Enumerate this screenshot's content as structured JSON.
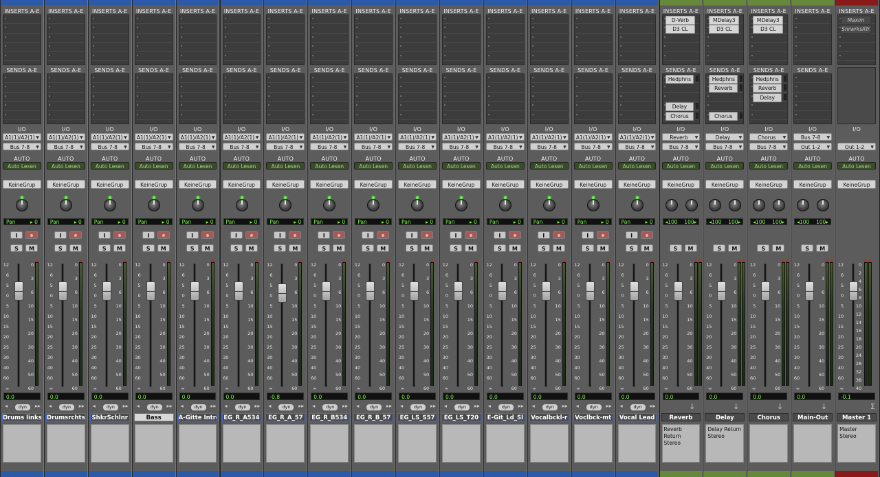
{
  "labels": {
    "inserts": "INSERTS A-E",
    "sends": "SENDS A-E",
    "io": "I/O",
    "auto": "AUTO",
    "auto_mode": "Auto Lesen",
    "group": "KeineGrup",
    "pan": "Pan",
    "pan_value": "0",
    "dyn": "dyn",
    "input_btn": "I",
    "solo": "S",
    "mute": "M"
  },
  "colors": {
    "blue": "#2c5aa8",
    "green": "#66883a",
    "red": "#8a1a1a"
  },
  "fader_scale": [
    "12",
    "6",
    "5",
    "0",
    "5",
    "10",
    "15",
    "20",
    "25",
    "30",
    "40",
    "60",
    "∞"
  ],
  "meter_scale": [
    "0",
    "3",
    "6",
    "10",
    "15",
    "20",
    "30",
    "40",
    "50",
    "60"
  ],
  "master_scale": [
    "0",
    "2",
    "4",
    "6",
    "8",
    "10",
    "12",
    "14",
    "16",
    "18",
    "20",
    "24",
    "28",
    "32",
    "38",
    "40"
  ],
  "tracks": [
    {
      "name": "Drums links",
      "in": "A1(1)/A2(1)",
      "out": "Bus 7-8",
      "vol": "0.0",
      "color": "blue",
      "selected": false,
      "inserts": [],
      "sends": []
    },
    {
      "name": "Drumsrchts",
      "in": "A1(1)/A2(1)",
      "out": "Bus 7-8",
      "vol": "0.0",
      "color": "blue",
      "selected": false,
      "inserts": [],
      "sends": []
    },
    {
      "name": "ShkrSchlnr",
      "in": "A1(1)/A2(1)",
      "out": "Bus 7-8",
      "vol": "0.0",
      "color": "blue",
      "selected": false,
      "inserts": [],
      "sends": []
    },
    {
      "name": "Bass",
      "in": "A1(1)/A2(1)",
      "out": "Bus 7-8",
      "vol": "0.0",
      "color": "blue",
      "selected": true,
      "inserts": [],
      "sends": []
    },
    {
      "name": "A-Gitte Intro",
      "in": "A1(1)/A2(1)",
      "out": "Bus 7-8",
      "vol": "0.0",
      "color": "blue",
      "selected": false,
      "inserts": [],
      "sends": []
    },
    {
      "name": "EG_R_A534",
      "in": "A1(1)/A2(1)",
      "out": "Bus 7-8",
      "vol": "0.0",
      "color": "blue",
      "selected": false,
      "inserts": [],
      "sends": []
    },
    {
      "name": "EG_R_A_57",
      "in": "A1(1)/A2(1)",
      "out": "Bus 7-8",
      "vol": "-0.8",
      "color": "blue",
      "selected": false,
      "inserts": [],
      "sends": []
    },
    {
      "name": "EG_R_B534",
      "in": "A1(1)/A2(1)",
      "out": "Bus 7-8",
      "vol": "0.0",
      "color": "blue",
      "selected": false,
      "inserts": [],
      "sends": []
    },
    {
      "name": "EG_R_B_57",
      "in": "A1(1)/A2(1)",
      "out": "Bus 7-8",
      "vol": "0.0",
      "color": "blue",
      "selected": false,
      "inserts": [],
      "sends": []
    },
    {
      "name": "EG_LS_S57",
      "in": "A1(1)/A2(1)",
      "out": "Bus 7-8",
      "vol": "0.0",
      "color": "blue",
      "selected": false,
      "inserts": [],
      "sends": []
    },
    {
      "name": "EG_LS_T20",
      "in": "A1(1)/A2(1)",
      "out": "Bus 7-8",
      "vol": "0.0",
      "color": "blue",
      "selected": false,
      "inserts": [],
      "sends": []
    },
    {
      "name": "E-Git_Ld_Sl",
      "in": "A1(1)/A2(1)",
      "out": "Bus 7-8",
      "vol": "0.0",
      "color": "blue",
      "selected": false,
      "inserts": [],
      "sends": []
    },
    {
      "name": "Vocalbckl-r",
      "in": "A1(1)/A2(1)",
      "out": "Bus 7-8",
      "vol": "0.0",
      "color": "blue",
      "selected": false,
      "inserts": [],
      "sends": []
    },
    {
      "name": "Voclbck-mt",
      "in": "A1(1)/A2(1)",
      "out": "Bus 7-8",
      "vol": "0.0",
      "color": "blue",
      "selected": false,
      "inserts": [],
      "sends": []
    },
    {
      "name": "Vocal Lead",
      "in": "A1(1)/A2(1)",
      "out": "Bus 7-8",
      "vol": "0.0",
      "color": "blue",
      "selected": false,
      "inserts": [],
      "sends": []
    },
    {
      "name": "Reverb",
      "in": "Reverb",
      "out": "Bus 7-8",
      "vol": "0.0",
      "color": "green",
      "selected": false,
      "aux": true,
      "inserts": [
        "D-Verb",
        "D3 CL"
      ],
      "sends": [
        "Hedphns",
        "",
        "",
        "Delay",
        "Chorus"
      ],
      "comment": "Reverb Return Stereo",
      "pan_left": "100",
      "pan_right": "100"
    },
    {
      "name": "Delay",
      "in": "Delay",
      "out": "Bus 7-8",
      "vol": "0.0",
      "color": "green",
      "selected": false,
      "aux": true,
      "inserts": [
        "MDelay3",
        "D3 CL"
      ],
      "sends": [
        "Hedphns",
        "Reverb",
        "",
        "",
        "Chorus"
      ],
      "comment": "Delay Return Stereo",
      "pan_left": "100",
      "pan_right": "100"
    },
    {
      "name": "Chorus",
      "in": "Chorus",
      "out": "Bus 7-8",
      "vol": "0.0",
      "color": "green",
      "selected": false,
      "aux": true,
      "inserts": [
        "MDelay3",
        "D3 CL"
      ],
      "sends": [
        "Hedphns",
        "Reverb",
        "Delay",
        "",
        ""
      ],
      "comment": "",
      "pan_left": "100",
      "pan_right": "100"
    },
    {
      "name": "Main-Out",
      "in": "Bus 7-8",
      "out": "Out 1-2",
      "vol": "0.0",
      "color": "green",
      "selected": false,
      "aux": true,
      "inserts": [],
      "sends": [],
      "comment": "",
      "pan_left": "100",
      "pan_right": "100"
    },
    {
      "name": "Master 1",
      "in": "",
      "out": "Out 1-2",
      "vol": "-0.1",
      "color": "red",
      "selected": false,
      "master": true,
      "inserts": [
        "Maxim",
        "SnrwrksRfr3"
      ],
      "sends": [],
      "comment": "Master Stereo"
    }
  ]
}
